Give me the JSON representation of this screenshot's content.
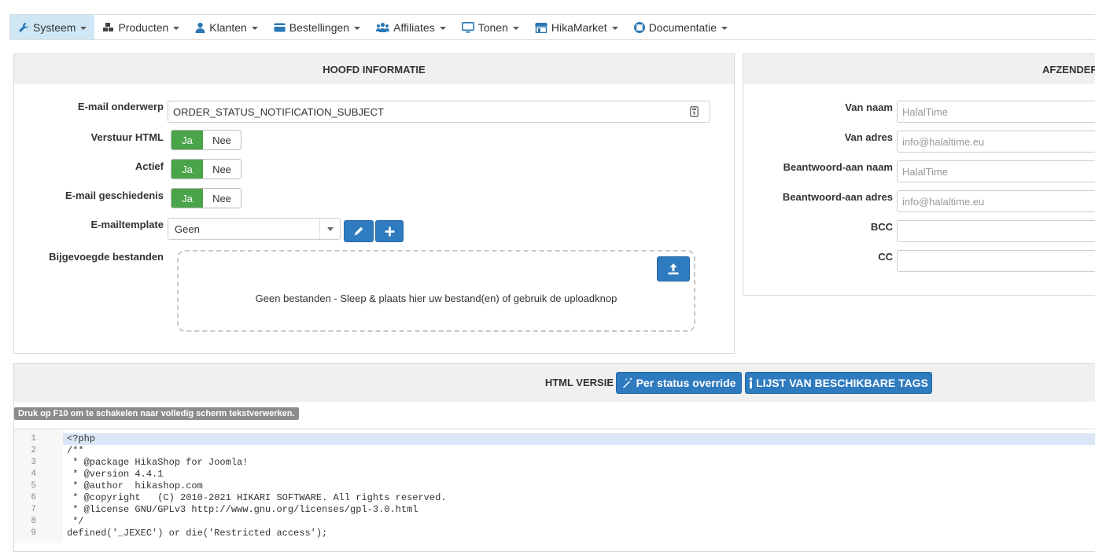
{
  "menu": [
    {
      "label": "Systeem",
      "icon": "wrench-icon",
      "active": true
    },
    {
      "label": "Producten",
      "icon": "cubes-icon"
    },
    {
      "label": "Klanten",
      "icon": "user-icon"
    },
    {
      "label": "Bestellingen",
      "icon": "credit-card-icon"
    },
    {
      "label": "Affiliates",
      "icon": "users-icon"
    },
    {
      "label": "Tonen",
      "icon": "monitor-icon"
    },
    {
      "label": "HikaMarket",
      "icon": "store-icon"
    },
    {
      "label": "Documentatie",
      "icon": "lifebuoy-icon"
    }
  ],
  "main": {
    "title": "HOOFD INFORMATIE",
    "subject_label": "E-mail onderwerp",
    "subject_value": "ORDER_STATUS_NOTIFICATION_SUBJECT",
    "html_label": "Verstuur HTML",
    "active_label": "Actief",
    "history_label": "E-mail geschiedenis",
    "yes": "Ja",
    "no": "Nee",
    "template_label": "E-mailtemplate",
    "template_value": "Geen",
    "attachments_label": "Bijgevoegde bestanden",
    "dropzone_text": "Geen bestanden - Sleep & plaats hier uw bestand(en) of gebruik de uploadknop"
  },
  "sender": {
    "title": "AFZENDER",
    "from_name_label": "Van naam",
    "from_name_placeholder": "HalalTime",
    "from_addr_label": "Van adres",
    "from_addr_placeholder": "info@halaltime.eu",
    "reply_name_label": "Beantwoord-aan naam",
    "reply_name_placeholder": "HalalTime",
    "reply_addr_label": "Beantwoord-aan adres",
    "reply_addr_placeholder": "info@halaltime.eu",
    "bcc_label": "BCC",
    "cc_label": "CC"
  },
  "html_section": {
    "title": "HTML VERSIE",
    "override_button": "Per status override",
    "tags_button": "LIJST VAN BESCHIKBARE TAGS",
    "hint": "Druk op F10 om te schakelen naar volledig scherm tekstverwerken."
  },
  "code": [
    {
      "n": "1",
      "t": "<?php"
    },
    {
      "n": "2",
      "t": "/**"
    },
    {
      "n": "3",
      "t": " * @package HikaShop for Joomla!"
    },
    {
      "n": "4",
      "t": " * @version 4.4.1"
    },
    {
      "n": "5",
      "t": " * @author  hikashop.com"
    },
    {
      "n": "6",
      "t": " * @copyright   (C) 2010-2021 HIKARI SOFTWARE. All rights reserved."
    },
    {
      "n": "7",
      "t": " * @license GNU/GPLv3 http://www.gnu.org/licenses/gpl-3.0.html"
    },
    {
      "n": "8",
      "t": " */"
    },
    {
      "n": "9",
      "t": "defined('_JEXEC') or die('Restricted access');"
    }
  ],
  "colors": {
    "accent": "#2f7bc0",
    "toggle_on": "#4aa449",
    "active_menu": "#cfe7f5"
  }
}
